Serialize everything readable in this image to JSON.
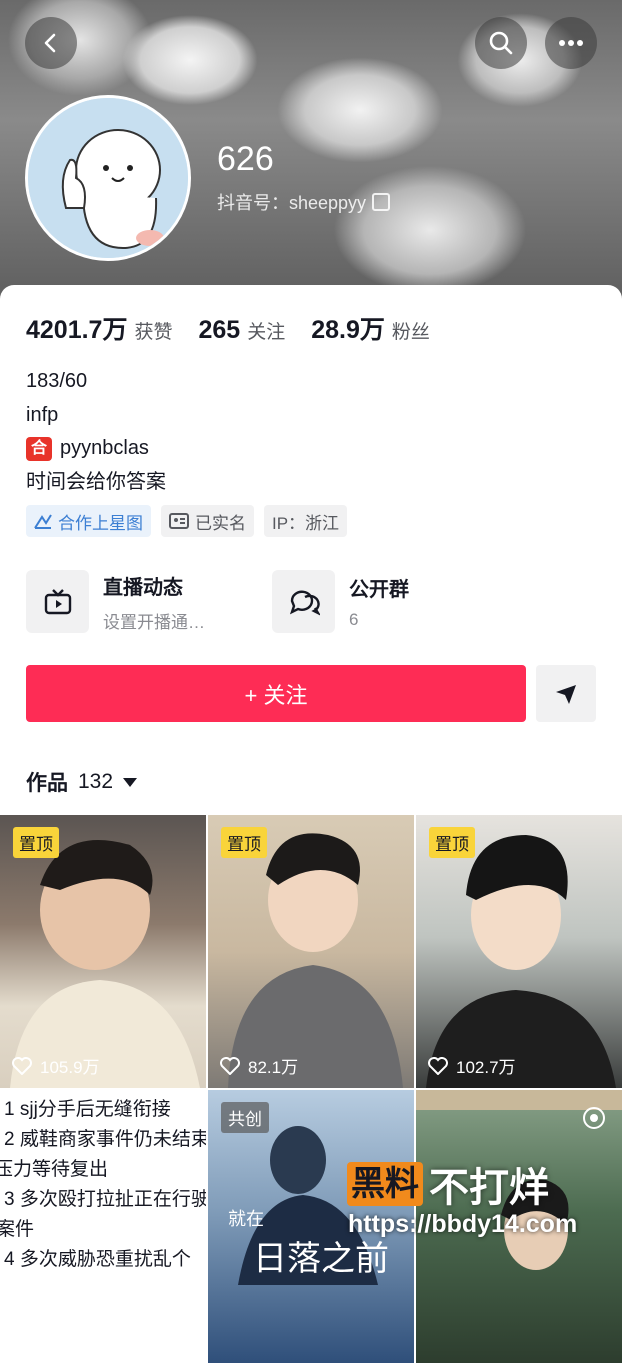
{
  "profile": {
    "username": "626",
    "douyin_id": "抖音号：sheeppyy",
    "stats": [
      {
        "value": "4201.7万",
        "label": "获赞"
      },
      {
        "value": "265",
        "label": "关注"
      },
      {
        "value": "28.9万",
        "label": "粉丝"
      }
    ],
    "bio": {
      "line1": "183/60",
      "line2": "infp",
      "line3_icon": "合",
      "line3": "pyynbclas",
      "line4": "时间会给你答案"
    },
    "tags": {
      "star": "合作上星图",
      "verified": "已实名",
      "ip": "IP：浙江"
    }
  },
  "features": {
    "live": {
      "title": "直播动态",
      "sub": "设置开播通…"
    },
    "group": {
      "title": "公开群",
      "sub": "6"
    }
  },
  "actions": {
    "follow_label": "+ 关注"
  },
  "works": {
    "label": "作品",
    "count": "132",
    "items": [
      {
        "pin": "置顶",
        "likes": "105.9万"
      },
      {
        "pin": "置顶",
        "likes": "82.1万"
      },
      {
        "pin": "置顶",
        "likes": "102.7万"
      }
    ],
    "text_post": [
      "1 sjj分手后无缝衔接",
      "2 威鞋商家事件仍未结束",
      "压力等待复出",
      "3 多次殴打拉扯正在行驶",
      "案件",
      "4 多次威胁恐重扰乱个"
    ],
    "cochuang": "共创",
    "poster_text": [
      "就在",
      "日落之前"
    ]
  },
  "watermark": {
    "box": "黑料",
    "text": "不打烊",
    "url": "https://bbdy14.com"
  }
}
